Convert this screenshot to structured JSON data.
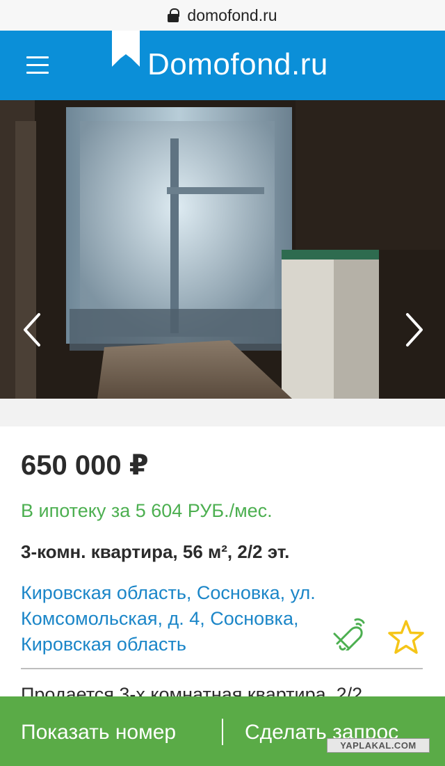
{
  "browser": {
    "url": "domofond.ru"
  },
  "header": {
    "logo_text": "Domofond.ru"
  },
  "listing": {
    "price": "650 000 ₽",
    "mortgage": "В ипотеку за 5 604 РУБ./мес.",
    "params": "3-комн. квартира, 56 м², 2/2 эт.",
    "address_line1": "Кировская область, Сосновка, ул.",
    "address_line2": "Комсомольская, д. 4, Сосновка,",
    "address_line3": "Кировская область",
    "description_preview": "Продается 3-х комнатная квартира, 2/2"
  },
  "actions": {
    "call_label": "Показать номер",
    "request_label": "Сделать запрос"
  },
  "watermark": "YAPLAKAL.COM",
  "icons": {
    "lock": "lock-icon",
    "menu": "hamburger-icon",
    "prev": "chevron-left-icon",
    "next": "chevron-right-icon",
    "bell": "bell-icon",
    "star": "star-icon"
  },
  "colors": {
    "header_blue": "#0b8fd8",
    "mortgage_green": "#4caf50",
    "address_blue": "#1b86c8",
    "action_green": "#5aab47",
    "star_yellow": "#f5c518"
  }
}
